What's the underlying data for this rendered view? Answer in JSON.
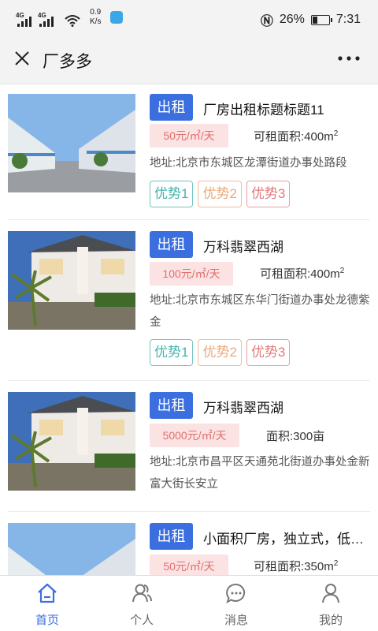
{
  "status_bar": {
    "network_1": "4G",
    "network_2": "4G",
    "speed_value": "0.9",
    "speed_unit": "K/s",
    "battery": "26%",
    "time": "7:31",
    "battery_level": 0.26
  },
  "header": {
    "title": "厂多多"
  },
  "listings": [
    {
      "tag": "出租",
      "title": "厂房出租标题标题11",
      "price": "50元/㎡/天",
      "area_label": "可租面积:400m",
      "area_sup": "2",
      "address": "地址:北京市东城区龙潭街道办事处路段",
      "features": [
        "优势1",
        "优势2",
        "优势3"
      ]
    },
    {
      "tag": "出租",
      "title": "万科翡翠西湖",
      "price": "100元/㎡/天",
      "area_label": "可租面积:400m",
      "area_sup": "2",
      "address": "地址:北京市东城区东华门街道办事处龙德紫金",
      "features": [
        "优势1",
        "优势2",
        "优势3"
      ]
    },
    {
      "tag": "出租",
      "title": "万科翡翠西湖",
      "price": "5000元/㎡/天",
      "area_label": "面积:300亩",
      "area_sup": "",
      "address": "地址:北京市昌平区天通苑北街道办事处金新富大街长安立",
      "features": []
    },
    {
      "tag": "出租",
      "title": "小面积厂房，独立式，低…",
      "price": "50元/㎡/天",
      "area_label": "可租面积:350m",
      "area_sup": "2",
      "address": "",
      "features": []
    }
  ],
  "tabbar": {
    "tabs": [
      {
        "label": "首页",
        "icon": "home-icon",
        "active": true
      },
      {
        "label": "个人",
        "icon": "people-icon",
        "active": false
      },
      {
        "label": "消息",
        "icon": "message-icon",
        "active": false
      },
      {
        "label": "我的",
        "icon": "user-icon",
        "active": false
      }
    ]
  },
  "colors": {
    "accent": "#3b6fe0",
    "price_bg": "#fbe3e3",
    "price_text": "#e0706e",
    "tag1": "#45b3ad",
    "tag2": "#e9a97a",
    "tag3": "#e07a7a"
  }
}
